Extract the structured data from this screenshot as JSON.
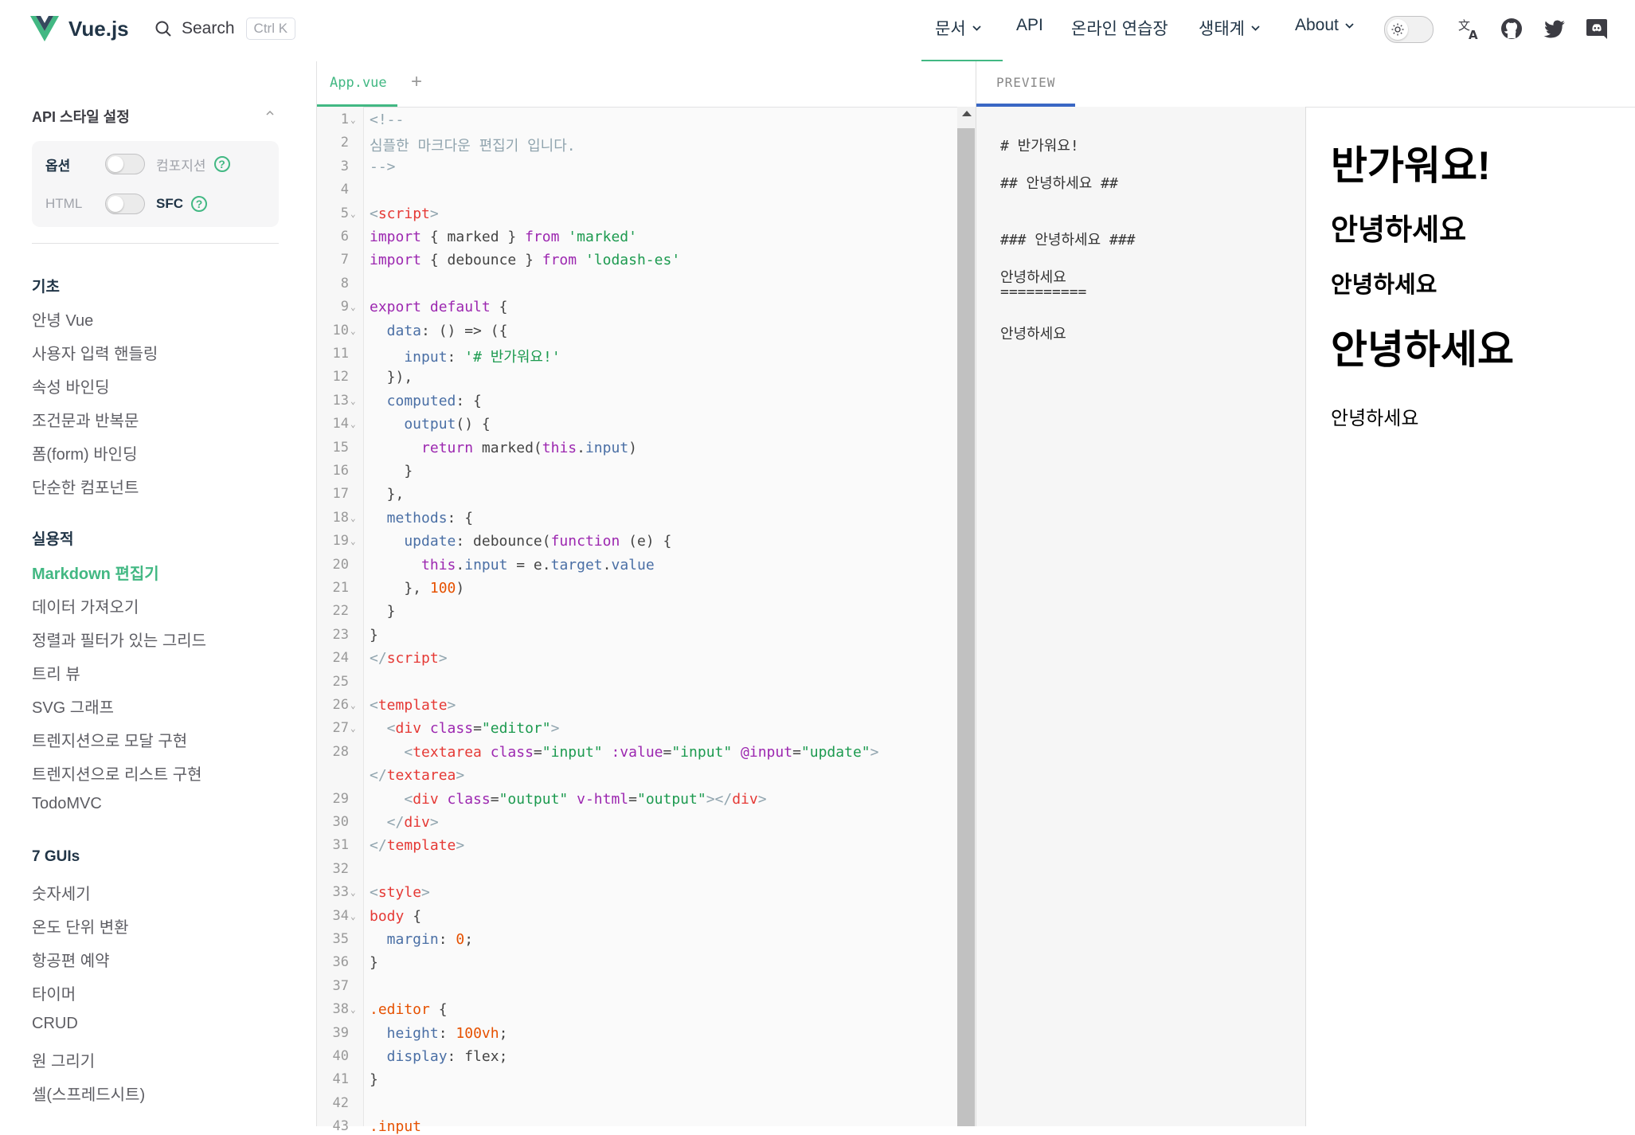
{
  "header": {
    "logo_text": "Vue.js",
    "search_label": "Search",
    "search_kbd": "Ctrl K",
    "nav": [
      {
        "label": "문서",
        "has_dropdown": true
      },
      {
        "label": "API",
        "has_dropdown": false
      },
      {
        "label": "온라인 연습장",
        "has_dropdown": false
      },
      {
        "label": "생태계",
        "has_dropdown": true
      },
      {
        "label": "About",
        "has_dropdown": true
      }
    ],
    "icons": [
      "sun-icon",
      "translate-icon",
      "github-icon",
      "twitter-icon",
      "discord-icon"
    ]
  },
  "sidebar": {
    "api_title": "API 스타일 설정",
    "api_row1": {
      "left": "옵션",
      "right": "컴포지션"
    },
    "api_row2": {
      "left": "HTML",
      "right": "SFC"
    },
    "help": "?",
    "groups": [
      {
        "title": "기초",
        "items": [
          "안녕 Vue",
          "사용자 입력 핸들링",
          "속성 바인딩",
          "조건문과 반복문",
          "폼(form) 바인딩",
          "단순한 컴포넌트"
        ]
      },
      {
        "title": "실용적",
        "items": [
          "Markdown 편집기",
          "데이터 가져오기",
          "정렬과 필터가 있는 그리드",
          "트리 뷰",
          "SVG 그래프",
          "트렌지션으로 모달 구현",
          "트렌지션으로 리스트 구현",
          "TodoMVC"
        ]
      },
      {
        "title": "7 GUIs",
        "items": [
          "숫자세기",
          "온도 단위 변환",
          "항공편 예약",
          "타이머",
          "CRUD",
          "원 그리기",
          "셀(스프레드시트)"
        ]
      }
    ],
    "active_item": "Markdown 편집기"
  },
  "editor": {
    "tab_file": "App.vue",
    "tab_add": "+",
    "lines": [
      {
        "n": "1",
        "fold": true,
        "t": [
          [
            "<!--",
            "#90a4ae"
          ]
        ]
      },
      {
        "n": "2",
        "t": [
          [
            "심플한 마크다운 편집기 입니다.",
            "#90a4ae"
          ]
        ]
      },
      {
        "n": "3",
        "t": [
          [
            "-->",
            "#90a4ae"
          ]
        ]
      },
      {
        "n": "4",
        "t": []
      },
      {
        "n": "5",
        "fold": true,
        "t": [
          [
            "<",
            "#90a4ae"
          ],
          [
            "script",
            "#e53935"
          ],
          [
            ">",
            "#90a4ae"
          ]
        ]
      },
      {
        "n": "6",
        "t": [
          [
            "import",
            "#9c27b0"
          ],
          [
            " { marked } ",
            "#444"
          ],
          [
            "from",
            "#9c27b0"
          ],
          [
            " ",
            "#444"
          ],
          [
            "'marked'",
            "#1c9a4f"
          ]
        ]
      },
      {
        "n": "7",
        "t": [
          [
            "import",
            "#9c27b0"
          ],
          [
            " { debounce } ",
            "#444"
          ],
          [
            "from",
            "#9c27b0"
          ],
          [
            " ",
            "#444"
          ],
          [
            "'lodash-es'",
            "#1c9a4f"
          ]
        ]
      },
      {
        "n": "8",
        "t": []
      },
      {
        "n": "9",
        "fold": true,
        "t": [
          [
            "export",
            "#9c27b0"
          ],
          [
            " ",
            "#444"
          ],
          [
            "default",
            "#9c27b0"
          ],
          [
            " {",
            "#444"
          ]
        ]
      },
      {
        "n": "10",
        "fold": true,
        "t": [
          [
            "  data",
            "#4a6fa5"
          ],
          [
            ": () => ({",
            "#444"
          ]
        ]
      },
      {
        "n": "11",
        "t": [
          [
            "    input",
            "#4a6fa5"
          ],
          [
            ": ",
            "#444"
          ],
          [
            "'# 반가워요!'",
            "#1c9a4f"
          ]
        ]
      },
      {
        "n": "12",
        "t": [
          [
            "  }),",
            "#444"
          ]
        ]
      },
      {
        "n": "13",
        "fold": true,
        "t": [
          [
            "  computed",
            "#4a6fa5"
          ],
          [
            ": {",
            "#444"
          ]
        ]
      },
      {
        "n": "14",
        "fold": true,
        "t": [
          [
            "    output",
            "#4a6fa5"
          ],
          [
            "() {",
            "#444"
          ]
        ]
      },
      {
        "n": "15",
        "t": [
          [
            "      ",
            "#444"
          ],
          [
            "return",
            "#9c27b0"
          ],
          [
            " marked(",
            "#444"
          ],
          [
            "this",
            "#9c27b0"
          ],
          [
            ".",
            "#444"
          ],
          [
            "input",
            "#4a6fa5"
          ],
          [
            ")",
            "#444"
          ]
        ]
      },
      {
        "n": "16",
        "t": [
          [
            "    }",
            "#444"
          ]
        ]
      },
      {
        "n": "17",
        "t": [
          [
            "  },",
            "#444"
          ]
        ]
      },
      {
        "n": "18",
        "fold": true,
        "t": [
          [
            "  methods",
            "#4a6fa5"
          ],
          [
            ": {",
            "#444"
          ]
        ]
      },
      {
        "n": "19",
        "fold": true,
        "t": [
          [
            "    update",
            "#4a6fa5"
          ],
          [
            ": debounce(",
            "#444"
          ],
          [
            "function",
            "#9c27b0"
          ],
          [
            " (e) {",
            "#444"
          ]
        ]
      },
      {
        "n": "20",
        "t": [
          [
            "      ",
            "#444"
          ],
          [
            "this",
            "#9c27b0"
          ],
          [
            ".",
            "#444"
          ],
          [
            "input",
            "#4a6fa5"
          ],
          [
            " = e.",
            "#444"
          ],
          [
            "target",
            "#4a6fa5"
          ],
          [
            ".",
            "#444"
          ],
          [
            "value",
            "#4a6fa5"
          ]
        ]
      },
      {
        "n": "21",
        "t": [
          [
            "    }, ",
            "#444"
          ],
          [
            "100",
            "#e65100"
          ],
          [
            ")",
            "#444"
          ]
        ]
      },
      {
        "n": "22",
        "t": [
          [
            "  }",
            "#444"
          ]
        ]
      },
      {
        "n": "23",
        "t": [
          [
            "}",
            "#444"
          ]
        ]
      },
      {
        "n": "24",
        "t": [
          [
            "</",
            "#90a4ae"
          ],
          [
            "script",
            "#e53935"
          ],
          [
            ">",
            "#90a4ae"
          ]
        ]
      },
      {
        "n": "25",
        "t": []
      },
      {
        "n": "26",
        "fold": true,
        "t": [
          [
            "<",
            "#90a4ae"
          ],
          [
            "template",
            "#e53935"
          ],
          [
            ">",
            "#90a4ae"
          ]
        ]
      },
      {
        "n": "27",
        "fold": true,
        "t": [
          [
            "  <",
            "#90a4ae"
          ],
          [
            "div",
            "#e53935"
          ],
          [
            " ",
            "#444"
          ],
          [
            "class",
            "#9c27b0"
          ],
          [
            "=",
            "#444"
          ],
          [
            "\"editor\"",
            "#1c9a4f"
          ],
          [
            ">",
            "#90a4ae"
          ]
        ]
      },
      {
        "n": "28",
        "t": [
          [
            "    <",
            "#90a4ae"
          ],
          [
            "textarea",
            "#e53935"
          ],
          [
            " ",
            "#444"
          ],
          [
            "class",
            "#9c27b0"
          ],
          [
            "=",
            "#444"
          ],
          [
            "\"input\"",
            "#1c9a4f"
          ],
          [
            " ",
            "#444"
          ],
          [
            ":value",
            "#9c27b0"
          ],
          [
            "=",
            "#444"
          ],
          [
            "\"input\"",
            "#1c9a4f"
          ],
          [
            " ",
            "#444"
          ],
          [
            "@input",
            "#9c27b0"
          ],
          [
            "=",
            "#444"
          ],
          [
            "\"update\"",
            "#1c9a4f"
          ],
          [
            ">",
            "#90a4ae"
          ]
        ]
      },
      {
        "n": "",
        "t": [
          [
            "</",
            "#90a4ae"
          ],
          [
            "textarea",
            "#e53935"
          ],
          [
            ">",
            "#90a4ae"
          ]
        ]
      },
      {
        "n": "29",
        "t": [
          [
            "    <",
            "#90a4ae"
          ],
          [
            "div",
            "#e53935"
          ],
          [
            " ",
            "#444"
          ],
          [
            "class",
            "#9c27b0"
          ],
          [
            "=",
            "#444"
          ],
          [
            "\"output\"",
            "#1c9a4f"
          ],
          [
            " ",
            "#444"
          ],
          [
            "v-html",
            "#9c27b0"
          ],
          [
            "=",
            "#444"
          ],
          [
            "\"output\"",
            "#1c9a4f"
          ],
          [
            "></",
            "#90a4ae"
          ],
          [
            "div",
            "#e53935"
          ],
          [
            ">",
            "#90a4ae"
          ]
        ]
      },
      {
        "n": "30",
        "t": [
          [
            "  </",
            "#90a4ae"
          ],
          [
            "div",
            "#e53935"
          ],
          [
            ">",
            "#90a4ae"
          ]
        ]
      },
      {
        "n": "31",
        "t": [
          [
            "</",
            "#90a4ae"
          ],
          [
            "template",
            "#e53935"
          ],
          [
            ">",
            "#90a4ae"
          ]
        ]
      },
      {
        "n": "32",
        "t": []
      },
      {
        "n": "33",
        "fold": true,
        "t": [
          [
            "<",
            "#90a4ae"
          ],
          [
            "style",
            "#e53935"
          ],
          [
            ">",
            "#90a4ae"
          ]
        ]
      },
      {
        "n": "34",
        "fold": true,
        "t": [
          [
            "body",
            "#e53935"
          ],
          [
            " {",
            "#444"
          ]
        ]
      },
      {
        "n": "35",
        "t": [
          [
            "  margin",
            "#4a6fa5"
          ],
          [
            ": ",
            "#444"
          ],
          [
            "0",
            "#e65100"
          ],
          [
            ";",
            "#444"
          ]
        ]
      },
      {
        "n": "36",
        "t": [
          [
            "}",
            "#444"
          ]
        ]
      },
      {
        "n": "37",
        "t": []
      },
      {
        "n": "38",
        "fold": true,
        "t": [
          [
            ".editor",
            "#e65100"
          ],
          [
            " {",
            "#444"
          ]
        ]
      },
      {
        "n": "39",
        "t": [
          [
            "  height",
            "#4a6fa5"
          ],
          [
            ": ",
            "#444"
          ],
          [
            "100vh",
            "#e65100"
          ],
          [
            ";",
            "#444"
          ]
        ]
      },
      {
        "n": "40",
        "t": [
          [
            "  display",
            "#4a6fa5"
          ],
          [
            ": flex;",
            "#444"
          ]
        ]
      },
      {
        "n": "41",
        "t": [
          [
            "}",
            "#444"
          ]
        ]
      },
      {
        "n": "42",
        "t": []
      },
      {
        "n": "43",
        "t": [
          [
            ".input",
            "#e65100"
          ]
        ]
      }
    ]
  },
  "preview": {
    "tab_label": "PREVIEW",
    "textarea_lines": [
      "# 반가워요!",
      "## 안녕하세요 ##",
      "",
      "### 안녕하세요 ###",
      "안녕하세요",
      "==========",
      "안녕하세요"
    ],
    "output": [
      {
        "text": "반가워요!",
        "level": "h1"
      },
      {
        "text": "안녕하세요",
        "level": "h2"
      },
      {
        "text": "안녕하세요",
        "level": "h3"
      },
      {
        "text": "안녕하세요",
        "level": "h1"
      },
      {
        "text": "안녕하세요",
        "level": "p"
      }
    ]
  },
  "colors": {
    "accent": "#42b883",
    "preview_accent": "#3a67c4"
  }
}
